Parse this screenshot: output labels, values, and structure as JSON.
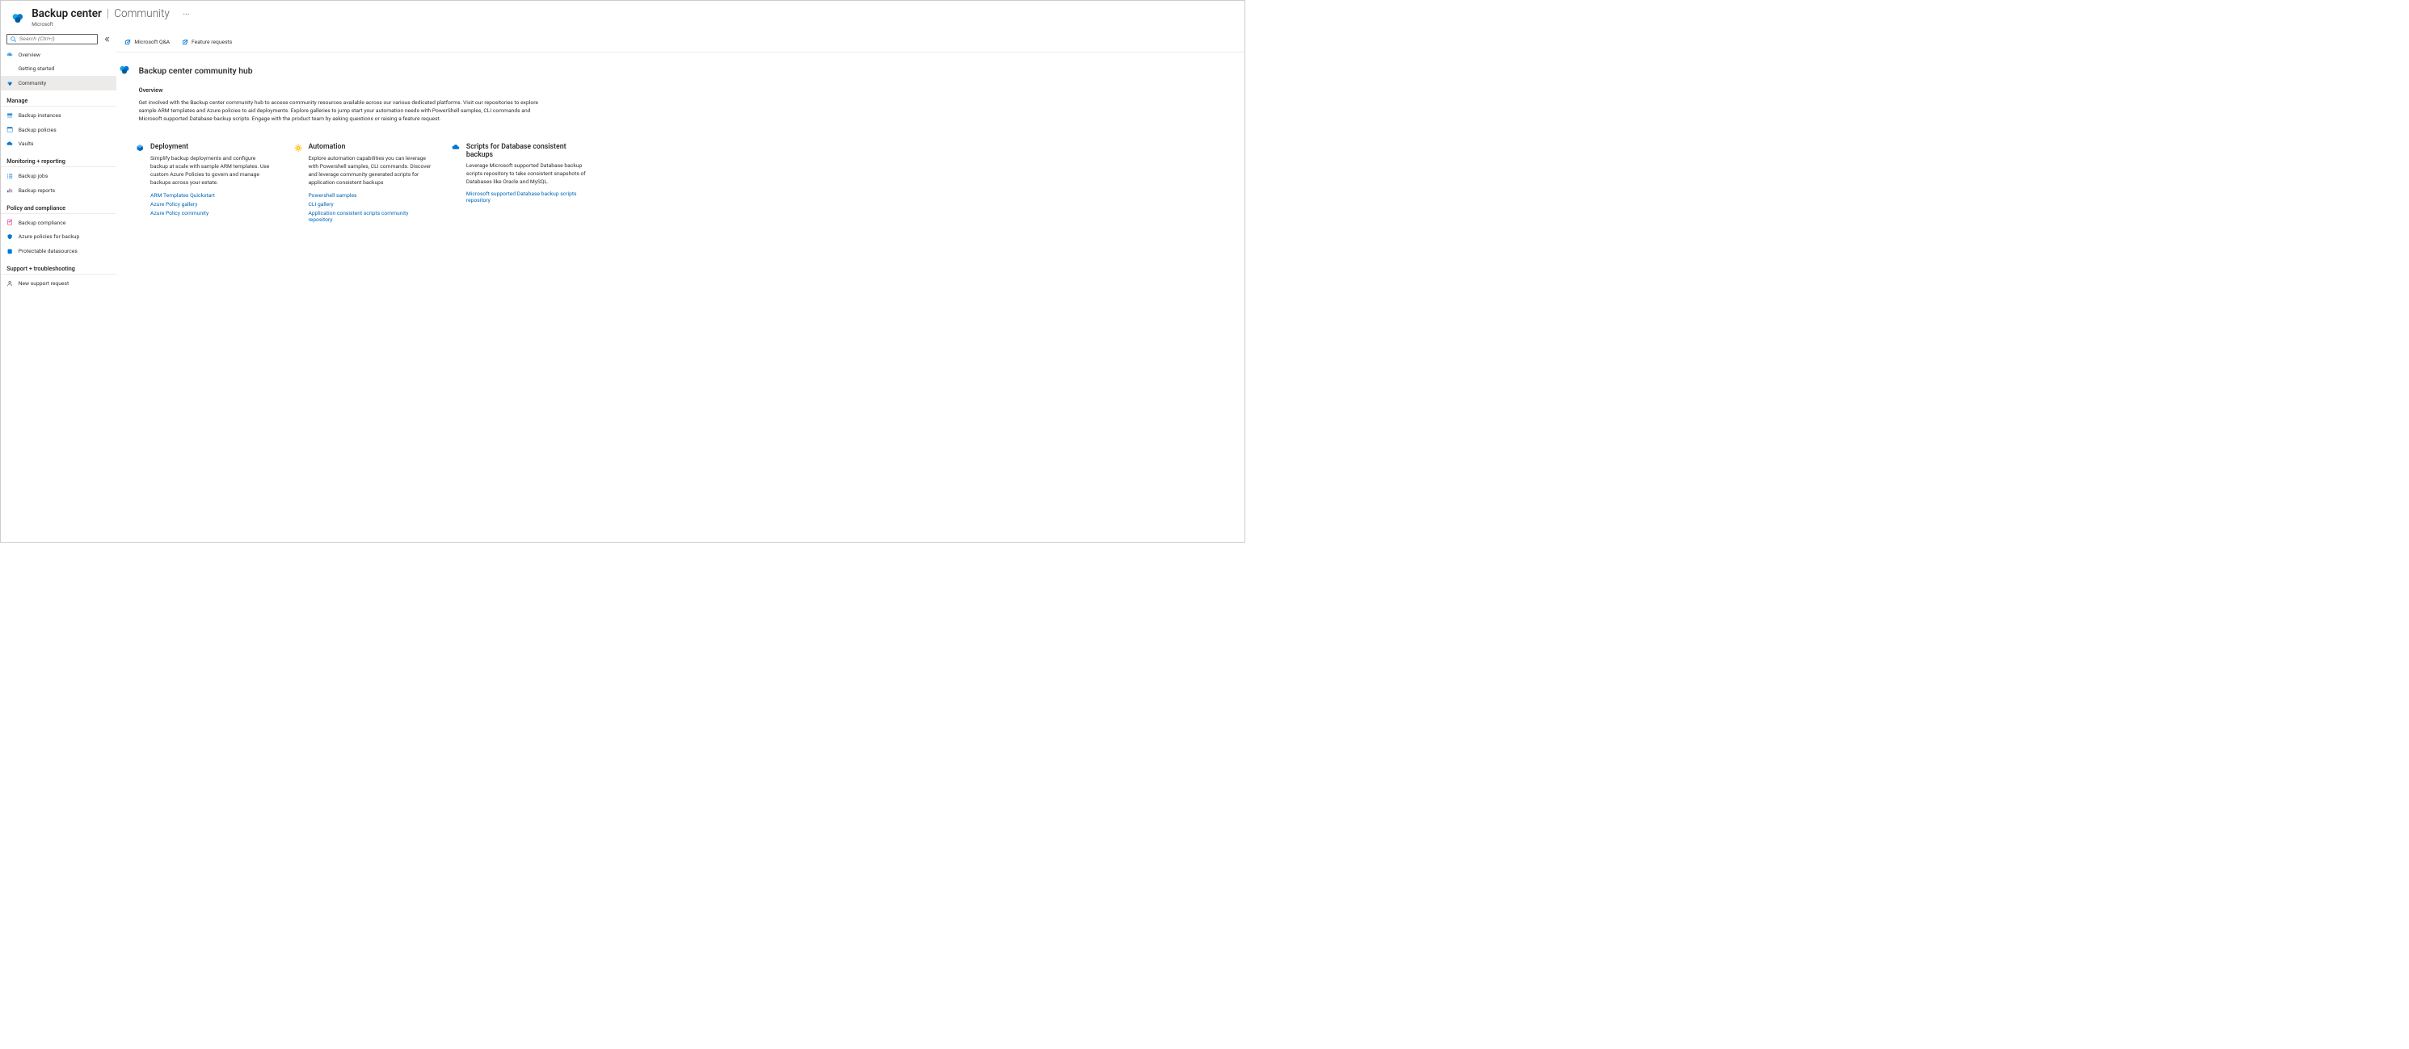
{
  "header": {
    "title": "Backup center",
    "subtitle": "Community",
    "breadcrumb": "Microsoft",
    "ellipsis": "···"
  },
  "search": {
    "placeholder": "Search (Ctrl+/)"
  },
  "nav": {
    "top": [
      {
        "label": "Overview"
      },
      {
        "label": "Getting started"
      },
      {
        "label": "Community"
      }
    ],
    "groups": [
      {
        "title": "Manage",
        "items": [
          {
            "label": "Backup instances"
          },
          {
            "label": "Backup policies"
          },
          {
            "label": "Vaults"
          }
        ]
      },
      {
        "title": "Monitoring + reporting",
        "items": [
          {
            "label": "Backup jobs"
          },
          {
            "label": "Backup reports"
          }
        ]
      },
      {
        "title": "Policy and compliance",
        "items": [
          {
            "label": "Backup compliance"
          },
          {
            "label": "Azure policies for backup"
          },
          {
            "label": "Protectable datasources"
          }
        ]
      },
      {
        "title": "Support + troubleshooting",
        "items": [
          {
            "label": "New support request"
          }
        ]
      }
    ]
  },
  "actions": {
    "qa": "Microsoft Q&A",
    "feature": "Feature requests"
  },
  "content": {
    "page_title": "Backup center community hub",
    "overview_heading": "Overview",
    "overview_text": "Get involved with the Backup center community hub to access community resources available across our various dedicated platforms. Visit our repositories to explore sample ARM templates and Azure policies to aid deployments. Explore galleries to jump start your automation needs with PowerShell samples, CLI commands and Microsoft supported Database backup scripts. Engage with the product team by asking questions or raising a feature request."
  },
  "tiles": [
    {
      "title": "Deployment",
      "desc": "Simplify backup deployments and configure backup at scale with sample ARM templates. Use custom Azure Policies to govern and manage backups across your estate.",
      "links": [
        "ARM Templates Quickstart",
        "Azure Policy gallery",
        "Azure Policy community"
      ]
    },
    {
      "title": "Automation",
      "desc": "Explore automation capabilities you can leverage with Powershell samples, CLI commands. Discover and leverage community generated scripts for application consistent backups",
      "links": [
        "Powershell samples",
        "CLI gallery",
        "Application consistent scripts community repository"
      ]
    },
    {
      "title": "Scripts for Database consistent backups",
      "desc": "Leverage Microsoft supported Database backup scripts repository to take consistent snapshots of Databases like Oracle and MySQL.",
      "links": [
        "Microsoft supported Database backup scripts repository"
      ]
    }
  ]
}
